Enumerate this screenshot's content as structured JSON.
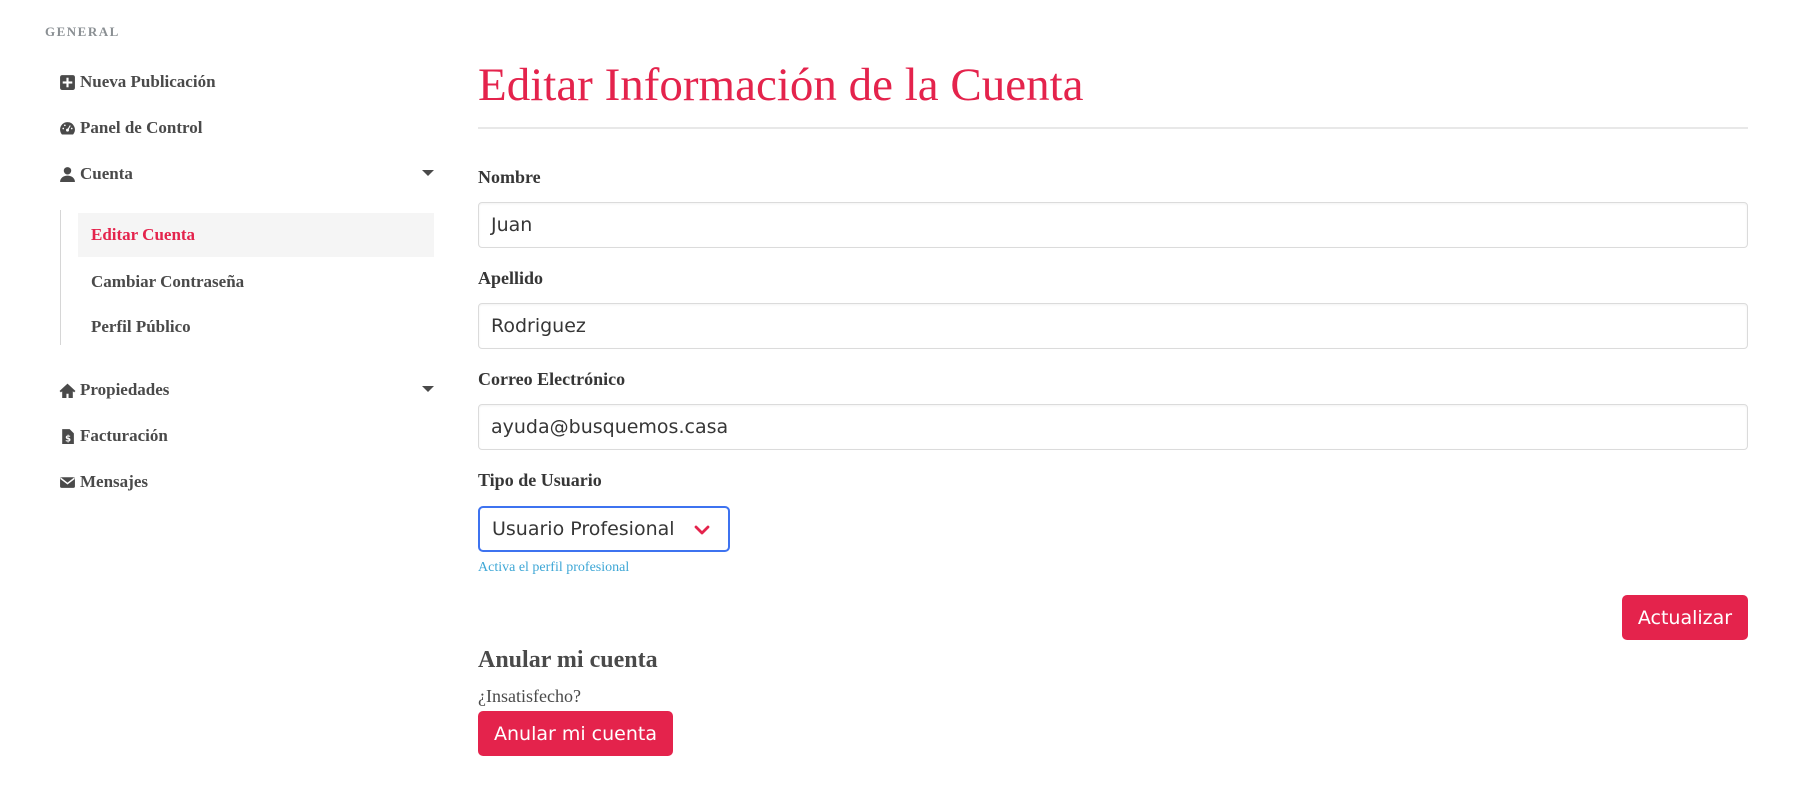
{
  "sidebar": {
    "heading": "GENERAL",
    "items": [
      {
        "label": "Nueva Publicación",
        "icon": "plus-square-icon"
      },
      {
        "label": "Panel de Control",
        "icon": "dashboard-gauge-icon"
      },
      {
        "label": "Cuenta",
        "icon": "user-icon",
        "expanded": true
      },
      {
        "label": "Propiedades",
        "icon": "home-icon"
      },
      {
        "label": "Facturación",
        "icon": "invoice-icon"
      },
      {
        "label": "Mensajes",
        "icon": "envelope-icon"
      }
    ],
    "account_submenu": [
      {
        "label": "Editar Cuenta",
        "active": true
      },
      {
        "label": "Cambiar Contraseña"
      },
      {
        "label": "Perfil Público"
      }
    ]
  },
  "main": {
    "title": "Editar Información de la Cuenta",
    "form": {
      "first_name": {
        "label": "Nombre",
        "value": "Juan"
      },
      "last_name": {
        "label": "Apellido",
        "value": "Rodriguez"
      },
      "email": {
        "label": "Correo Electrónico",
        "value": "ayuda@busquemos.casa"
      },
      "user_type": {
        "label": "Tipo de Usuario",
        "selected": "Usuario Profesional",
        "help": "Activa el perfil profesional"
      }
    },
    "update_button": "Actualizar",
    "cancel_section": {
      "title": "Anular mi cuenta",
      "subtitle": "¿Insatisfecho?",
      "button": "Anular mi cuenta"
    }
  },
  "colors": {
    "accent": "#e4234c",
    "text": "#4a4a4a",
    "help": "#3ea7d6",
    "focus_border": "#3e73f0"
  }
}
